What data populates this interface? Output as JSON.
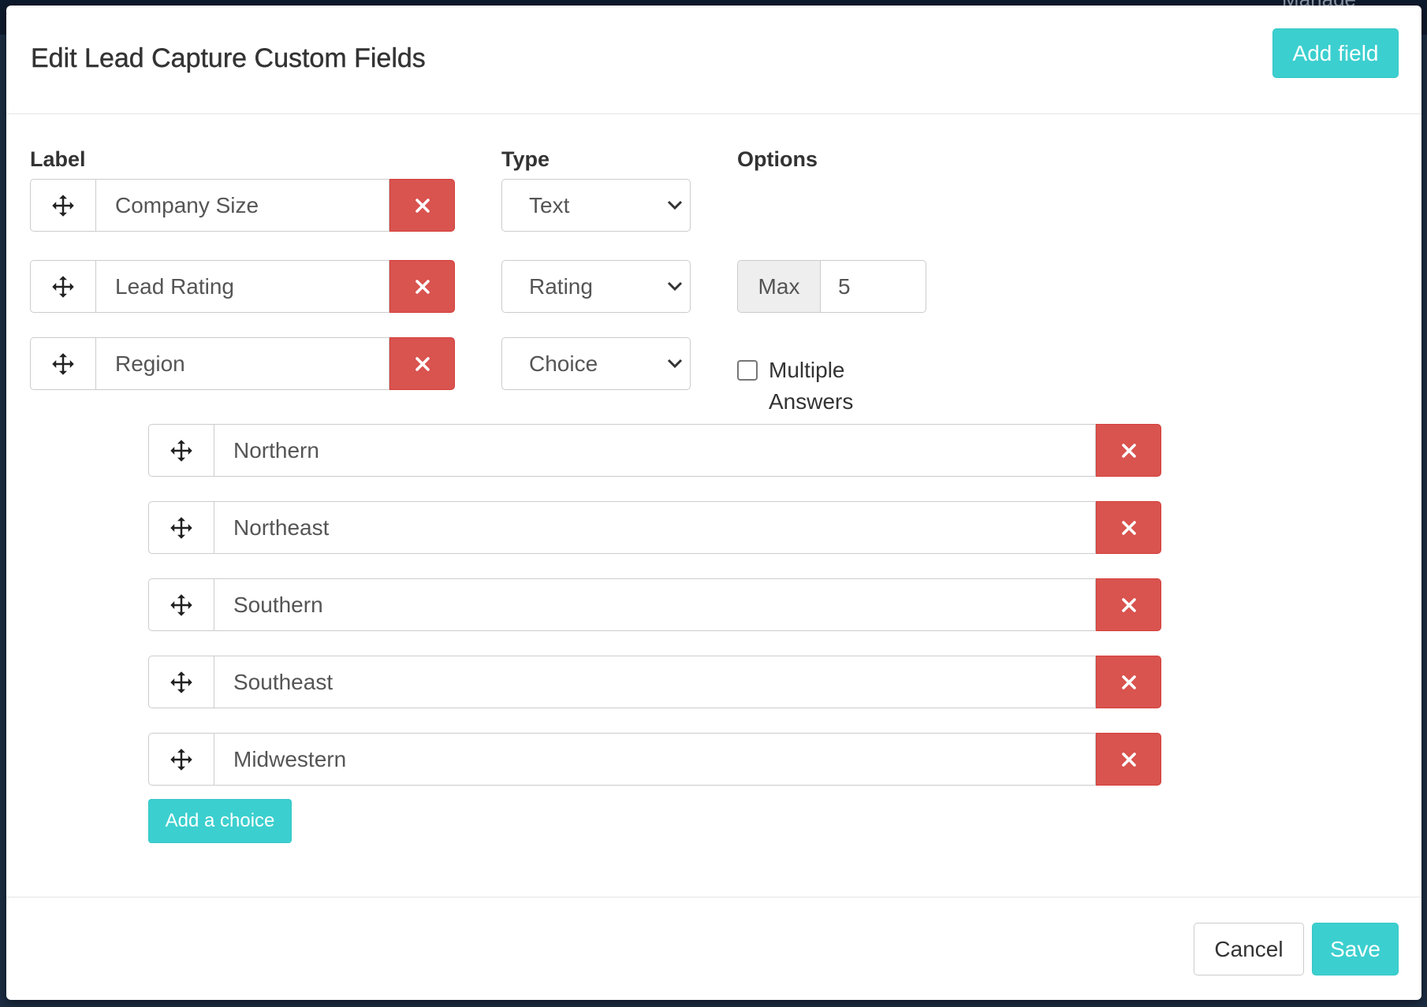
{
  "backdrop": {
    "partial_menu_text": "Manage"
  },
  "modal": {
    "title": "Edit Lead Capture Custom Fields",
    "add_field_label": "Add field",
    "columns": {
      "label": "Label",
      "type": "Type",
      "options": "Options"
    },
    "fields": [
      {
        "label": "Company Size",
        "type": "Text"
      },
      {
        "label": "Lead Rating",
        "type": "Rating",
        "max_label": "Max",
        "max_value": "5"
      },
      {
        "label": "Region",
        "type": "Choice",
        "multiple_answers_label": "Multiple Answers",
        "multiple_answers_checked": false
      }
    ],
    "choices": [
      "Northern",
      "Northeast",
      "Southern",
      "Southeast",
      "Midwestern"
    ],
    "add_choice_label": "Add a choice",
    "footer": {
      "cancel_label": "Cancel",
      "save_label": "Save"
    }
  },
  "colors": {
    "accent": "#3ccfcf",
    "danger": "#d9534f",
    "backdrop": "#1c2c42"
  },
  "icons": {
    "drag": "move-arrows-icon",
    "delete": "close-x-icon",
    "select": "chevron-down-icon"
  }
}
